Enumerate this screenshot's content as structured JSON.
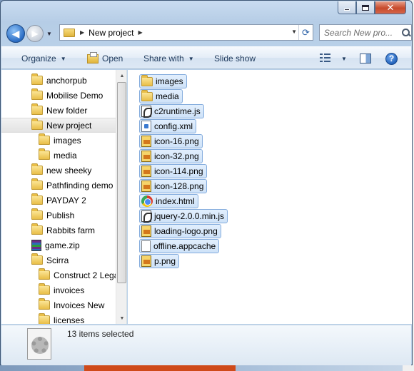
{
  "window": {
    "caption_buttons": {
      "minimize_icon": "minimize-icon",
      "maximize_icon": "maximize-icon",
      "close_glyph": "✕"
    }
  },
  "navigation": {
    "back_glyph": "◀",
    "forward_glyph": "▶",
    "breadcrumb": [
      "New project"
    ],
    "search_placeholder": "Search New pro..."
  },
  "toolbar": {
    "organize": "Organize",
    "open": "Open",
    "share_with": "Share with",
    "slide_show": "Slide show"
  },
  "nav_tree": [
    {
      "label": "anchorpub",
      "icon": "folder"
    },
    {
      "label": "Mobilise Demo",
      "icon": "folder"
    },
    {
      "label": "New folder",
      "icon": "folder"
    },
    {
      "label": "New project",
      "icon": "folder",
      "selected": true
    },
    {
      "label": "images",
      "icon": "folder",
      "indent": 1
    },
    {
      "label": "media",
      "icon": "folder",
      "indent": 1
    },
    {
      "label": "new sheeky",
      "icon": "folder"
    },
    {
      "label": "Pathfinding demo",
      "icon": "folder"
    },
    {
      "label": "PAYDAY 2",
      "icon": "folder"
    },
    {
      "label": "Publish",
      "icon": "folder"
    },
    {
      "label": "Rabbits farm",
      "icon": "folder"
    },
    {
      "label": "game.zip",
      "icon": "zip"
    },
    {
      "label": "Scirra",
      "icon": "folder"
    },
    {
      "label": "Construct 2 Lega",
      "icon": "folder",
      "indent": 1
    },
    {
      "label": "invoices",
      "icon": "folder",
      "indent": 1
    },
    {
      "label": "Invoices New",
      "icon": "folder",
      "indent": 1
    },
    {
      "label": "licenses",
      "icon": "folder",
      "indent": 1
    }
  ],
  "files": [
    {
      "name": "images",
      "icon": "folder"
    },
    {
      "name": "media",
      "icon": "folder"
    },
    {
      "name": "c2runtime.js",
      "icon": "js"
    },
    {
      "name": "config.xml",
      "icon": "xml"
    },
    {
      "name": "icon-16.png",
      "icon": "png"
    },
    {
      "name": "icon-32.png",
      "icon": "png"
    },
    {
      "name": "icon-114.png",
      "icon": "png"
    },
    {
      "name": "icon-128.png",
      "icon": "png"
    },
    {
      "name": "index.html",
      "icon": "html"
    },
    {
      "name": "jquery-2.0.0.min.js",
      "icon": "js"
    },
    {
      "name": "loading-logo.png",
      "icon": "png"
    },
    {
      "name": "offline.appcache",
      "icon": "doc"
    },
    {
      "name": "p.png",
      "icon": "png"
    }
  ],
  "details": {
    "selection_text": "13 items selected"
  },
  "colors": {
    "selection_fill": "#cee2f8",
    "selection_border": "#84acdd",
    "toolbar_text": "#1e395b"
  }
}
